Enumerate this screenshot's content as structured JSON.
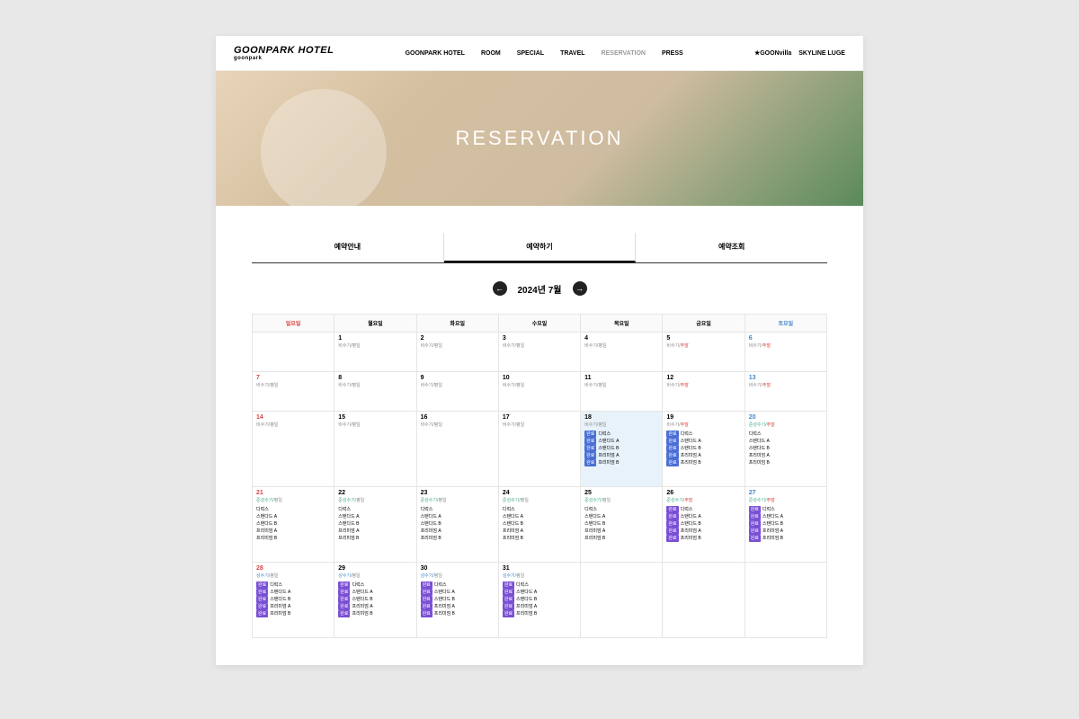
{
  "logo": {
    "main": "GOONPARK HOTEL",
    "sub": "goonpark"
  },
  "nav": [
    "GOONPARK HOTEL",
    "ROOM",
    "SPECIAL",
    "TRAVEL",
    "RESERVATION",
    "PRESS"
  ],
  "nav_active": 4,
  "brands": [
    "★GOONvilla",
    "SKYLINE LUGE"
  ],
  "hero": "RESERVATION",
  "tabs": [
    "예약안내",
    "예약하기",
    "예약조회"
  ],
  "tab_active": 1,
  "month_label": "2024년 7월",
  "weekdays": [
    "일요일",
    "월요일",
    "화요일",
    "수요일",
    "목요일",
    "금요일",
    "토요일"
  ],
  "badge_text": "완료",
  "rooms_default": [
    "디럭스",
    "스탠다드 A",
    "스탠다드 B",
    "프리미엄 A",
    "프리미엄 B"
  ],
  "weeks": [
    [
      {
        "n": "",
        "s": ""
      },
      {
        "n": "1",
        "s": "비수기/평일"
      },
      {
        "n": "2",
        "s": "비수기/평일"
      },
      {
        "n": "3",
        "s": "비수기/평일"
      },
      {
        "n": "4",
        "s": "비수기/평일"
      },
      {
        "n": "5",
        "s": "비수기/",
        "wk": "주말"
      },
      {
        "n": "6",
        "s": "비수기/",
        "wk": "주말",
        "sat": true
      }
    ],
    [
      {
        "n": "7",
        "s": "비수기/평일",
        "sun": true
      },
      {
        "n": "8",
        "s": "비수기/평일"
      },
      {
        "n": "9",
        "s": "비수기/평일"
      },
      {
        "n": "10",
        "s": "비수기/평일"
      },
      {
        "n": "11",
        "s": "비수기/평일"
      },
      {
        "n": "12",
        "s": "비수기/",
        "wk": "주말"
      },
      {
        "n": "13",
        "s": "비수기/",
        "wk": "주말",
        "sat": true
      }
    ],
    [
      {
        "n": "14",
        "s": "비수기/평일",
        "sun": true
      },
      {
        "n": "15",
        "s": "비수기/평일"
      },
      {
        "n": "16",
        "s": "비수기/평일"
      },
      {
        "n": "17",
        "s": "비수기/평일"
      },
      {
        "n": "18",
        "s": "비수기/평일",
        "today": true,
        "rooms": true,
        "badge": "b1"
      },
      {
        "n": "19",
        "s": "비수기/",
        "wk": "주말",
        "rooms": true,
        "badge": "b1"
      },
      {
        "n": "20",
        "mid": "준성수기/",
        "wk": "주말",
        "sat": true,
        "rooms": true
      }
    ],
    [
      {
        "n": "21",
        "mid": "준성수기/",
        "s2": "평일",
        "sun": true,
        "rooms": true
      },
      {
        "n": "22",
        "mid": "준성수기/",
        "s2": "평일",
        "rooms": true
      },
      {
        "n": "23",
        "mid": "준성수기/",
        "s2": "평일",
        "rooms": true
      },
      {
        "n": "24",
        "mid": "준성수기/",
        "s2": "평일",
        "rooms": true
      },
      {
        "n": "25",
        "mid": "준성수기/",
        "s2": "평일",
        "rooms": true
      },
      {
        "n": "26",
        "mid": "준성수기/",
        "wk": "주말",
        "rooms": true,
        "badge": "b2"
      },
      {
        "n": "27",
        "mid": "준성수기/",
        "wk": "주말",
        "sat": true,
        "rooms": true,
        "badge": "b2"
      }
    ],
    [
      {
        "n": "28",
        "peak": "성수기/",
        "s2": "평일",
        "sun": true,
        "rooms": true,
        "badge": "b2"
      },
      {
        "n": "29",
        "peak": "성수기/",
        "s2": "평일",
        "rooms": true,
        "badge": "b2"
      },
      {
        "n": "30",
        "peak": "성수기/",
        "s2": "평일",
        "rooms": true,
        "badge": "b2"
      },
      {
        "n": "31",
        "peak": "성수기/",
        "s2": "평일",
        "rooms": true,
        "badge": "b2"
      },
      {
        "n": "",
        "s": ""
      },
      {
        "n": "",
        "s": ""
      },
      {
        "n": "",
        "s": ""
      }
    ]
  ]
}
